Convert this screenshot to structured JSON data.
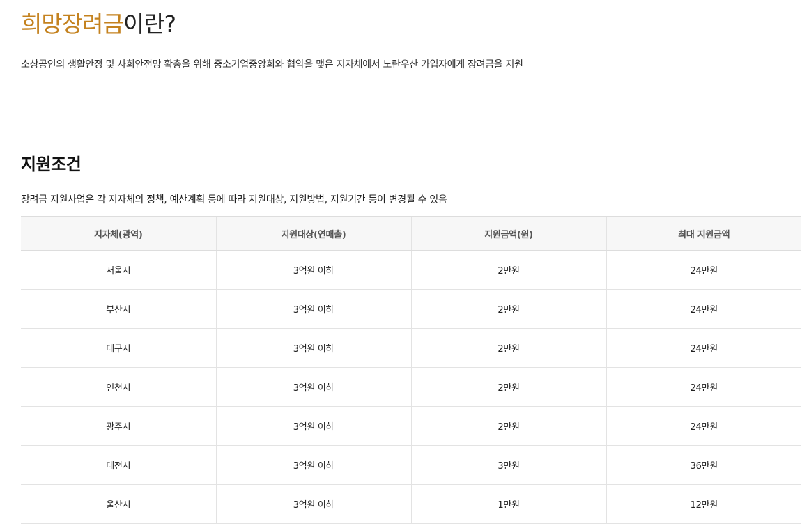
{
  "header": {
    "title_accent": "희망장려금",
    "title_rest": "이란?",
    "intro": "소상공인의 생활안정 및 사회안전망 확충을 위해 중소기업중앙회와 협약을 맺은 지자체에서 노란우산 가입자에게 장려금을 지원"
  },
  "section": {
    "title": "지원조건",
    "description": "장려금 지원사업은 각 지자체의 정책, 예산계획 등에 따라 지원대상, 지원방법, 지원기간 등이 변경될 수 있음"
  },
  "table": {
    "headers": [
      "지자체(광역)",
      "지원대상(연매출)",
      "지원금액(원)",
      "최대 지원금액"
    ],
    "rows": [
      [
        "서울시",
        "3억원 이하",
        "2만원",
        "24만원"
      ],
      [
        "부산시",
        "3억원 이하",
        "2만원",
        "24만원"
      ],
      [
        "대구시",
        "3억원 이하",
        "2만원",
        "24만원"
      ],
      [
        "인천시",
        "3억원 이하",
        "2만원",
        "24만원"
      ],
      [
        "광주시",
        "3억원 이하",
        "2만원",
        "24만원"
      ],
      [
        "대전시",
        "3억원 이하",
        "3만원",
        "36만원"
      ],
      [
        "울산시",
        "3억원 이하",
        "1만원",
        "12만원"
      ]
    ]
  },
  "colors": {
    "accent": "#c4821f",
    "text": "#222222",
    "header_bg": "#f7f7f7"
  }
}
